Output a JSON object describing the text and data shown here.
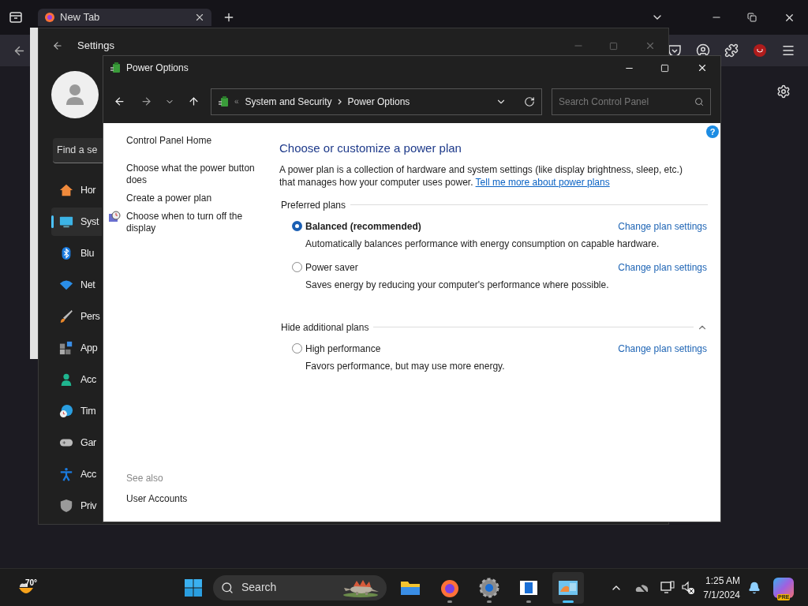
{
  "browser": {
    "tab": {
      "title": "New Tab",
      "selected": true
    }
  },
  "settings": {
    "title": "Settings",
    "search": {
      "placeholder": "Find a se"
    },
    "nav": [
      {
        "label": "Hor",
        "selected": false
      },
      {
        "label": "Syst",
        "selected": true
      },
      {
        "label": "Blu",
        "selected": false
      },
      {
        "label": "Net",
        "selected": false
      },
      {
        "label": "Pers",
        "selected": false
      },
      {
        "label": "App",
        "selected": false
      },
      {
        "label": "Acc",
        "selected": false
      },
      {
        "label": "Tim",
        "selected": false
      },
      {
        "label": "Gar",
        "selected": false
      },
      {
        "label": "Acc",
        "selected": false
      },
      {
        "label": "Priv",
        "selected": false
      }
    ]
  },
  "power_options": {
    "title": "Power Options",
    "address": {
      "overflow": "«",
      "crumbs": [
        "System and Security",
        "Power Options"
      ]
    },
    "search": {
      "placeholder": "Search Control Panel"
    },
    "sidebar": {
      "links": [
        {
          "label": "Control Panel Home",
          "kind": "home"
        },
        {
          "label": "Choose what the power button does",
          "kind": "link"
        },
        {
          "label": "Create a power plan",
          "kind": "link"
        },
        {
          "label": "Choose when to turn off the display",
          "kind": "icon_link"
        }
      ],
      "see_also": {
        "heading": "See also",
        "links": [
          "User Accounts"
        ]
      }
    },
    "help_label": "?",
    "heading": "Choose or customize a power plan",
    "description": "A power plan is a collection of hardware and system settings (like display brightness, sleep, etc.) that manages how your computer uses power.",
    "description_link": "Tell me more about power plans",
    "sections": [
      {
        "title": "Preferred plans",
        "collapsible": false,
        "plans": [
          {
            "name": "Balanced (recommended)",
            "selected": true,
            "description": "Automatically balances performance with energy consumption on capable hardware.",
            "link": "Change plan settings"
          },
          {
            "name": "Power saver",
            "selected": false,
            "description": "Saves energy by reducing your computer's performance where possible.",
            "link": "Change plan settings"
          }
        ]
      },
      {
        "title": "Hide additional plans",
        "collapsible": true,
        "plans": [
          {
            "name": "High performance",
            "selected": false,
            "description": "Favors performance, but may use more energy.",
            "link": "Change plan settings"
          }
        ]
      }
    ]
  },
  "taskbar": {
    "weather": "70°",
    "search": {
      "placeholder": "Search"
    },
    "apps": [
      {
        "running": false,
        "selected": false
      },
      {
        "running": true,
        "selected": false
      },
      {
        "running": true,
        "selected": false
      },
      {
        "running": true,
        "selected": false
      },
      {
        "running": true,
        "selected": true
      }
    ],
    "time": "1:25 AM",
    "date": "7/1/2024",
    "copilot_badge": "PRE"
  }
}
